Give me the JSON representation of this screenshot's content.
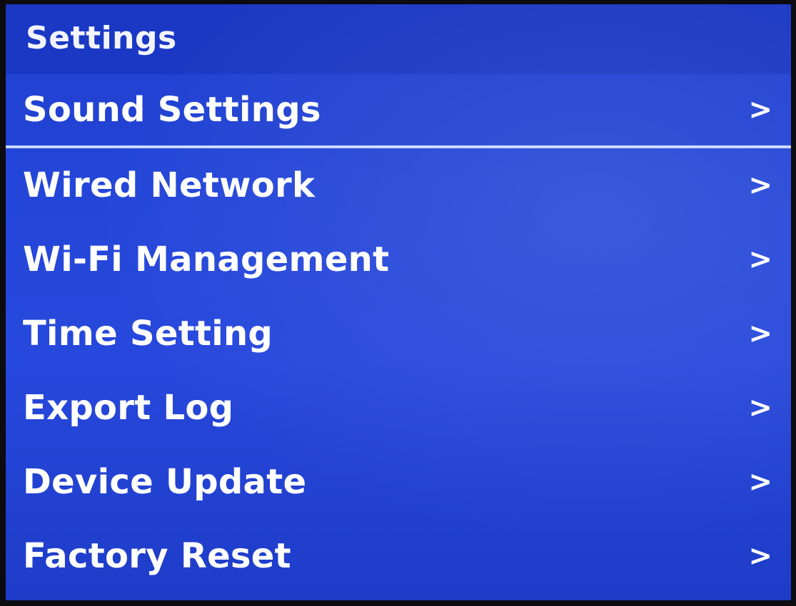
{
  "title": "Settings",
  "items": [
    {
      "label": "Sound Settings",
      "chevron": ">",
      "selected": true
    },
    {
      "label": "Wired Network",
      "chevron": ">",
      "selected": false
    },
    {
      "label": "Wi-Fi Management",
      "chevron": ">",
      "selected": false
    },
    {
      "label": "Time Setting",
      "chevron": ">",
      "selected": false
    },
    {
      "label": "Export Log",
      "chevron": ">",
      "selected": false
    },
    {
      "label": "Device Update",
      "chevron": ">",
      "selected": false
    },
    {
      "label": "Factory Reset",
      "chevron": ">",
      "selected": false
    }
  ],
  "colors": {
    "background": "#2446d8",
    "title_bar": "#1a38c4",
    "selection_line": "#c9d8ff",
    "text": "#ffffff"
  }
}
